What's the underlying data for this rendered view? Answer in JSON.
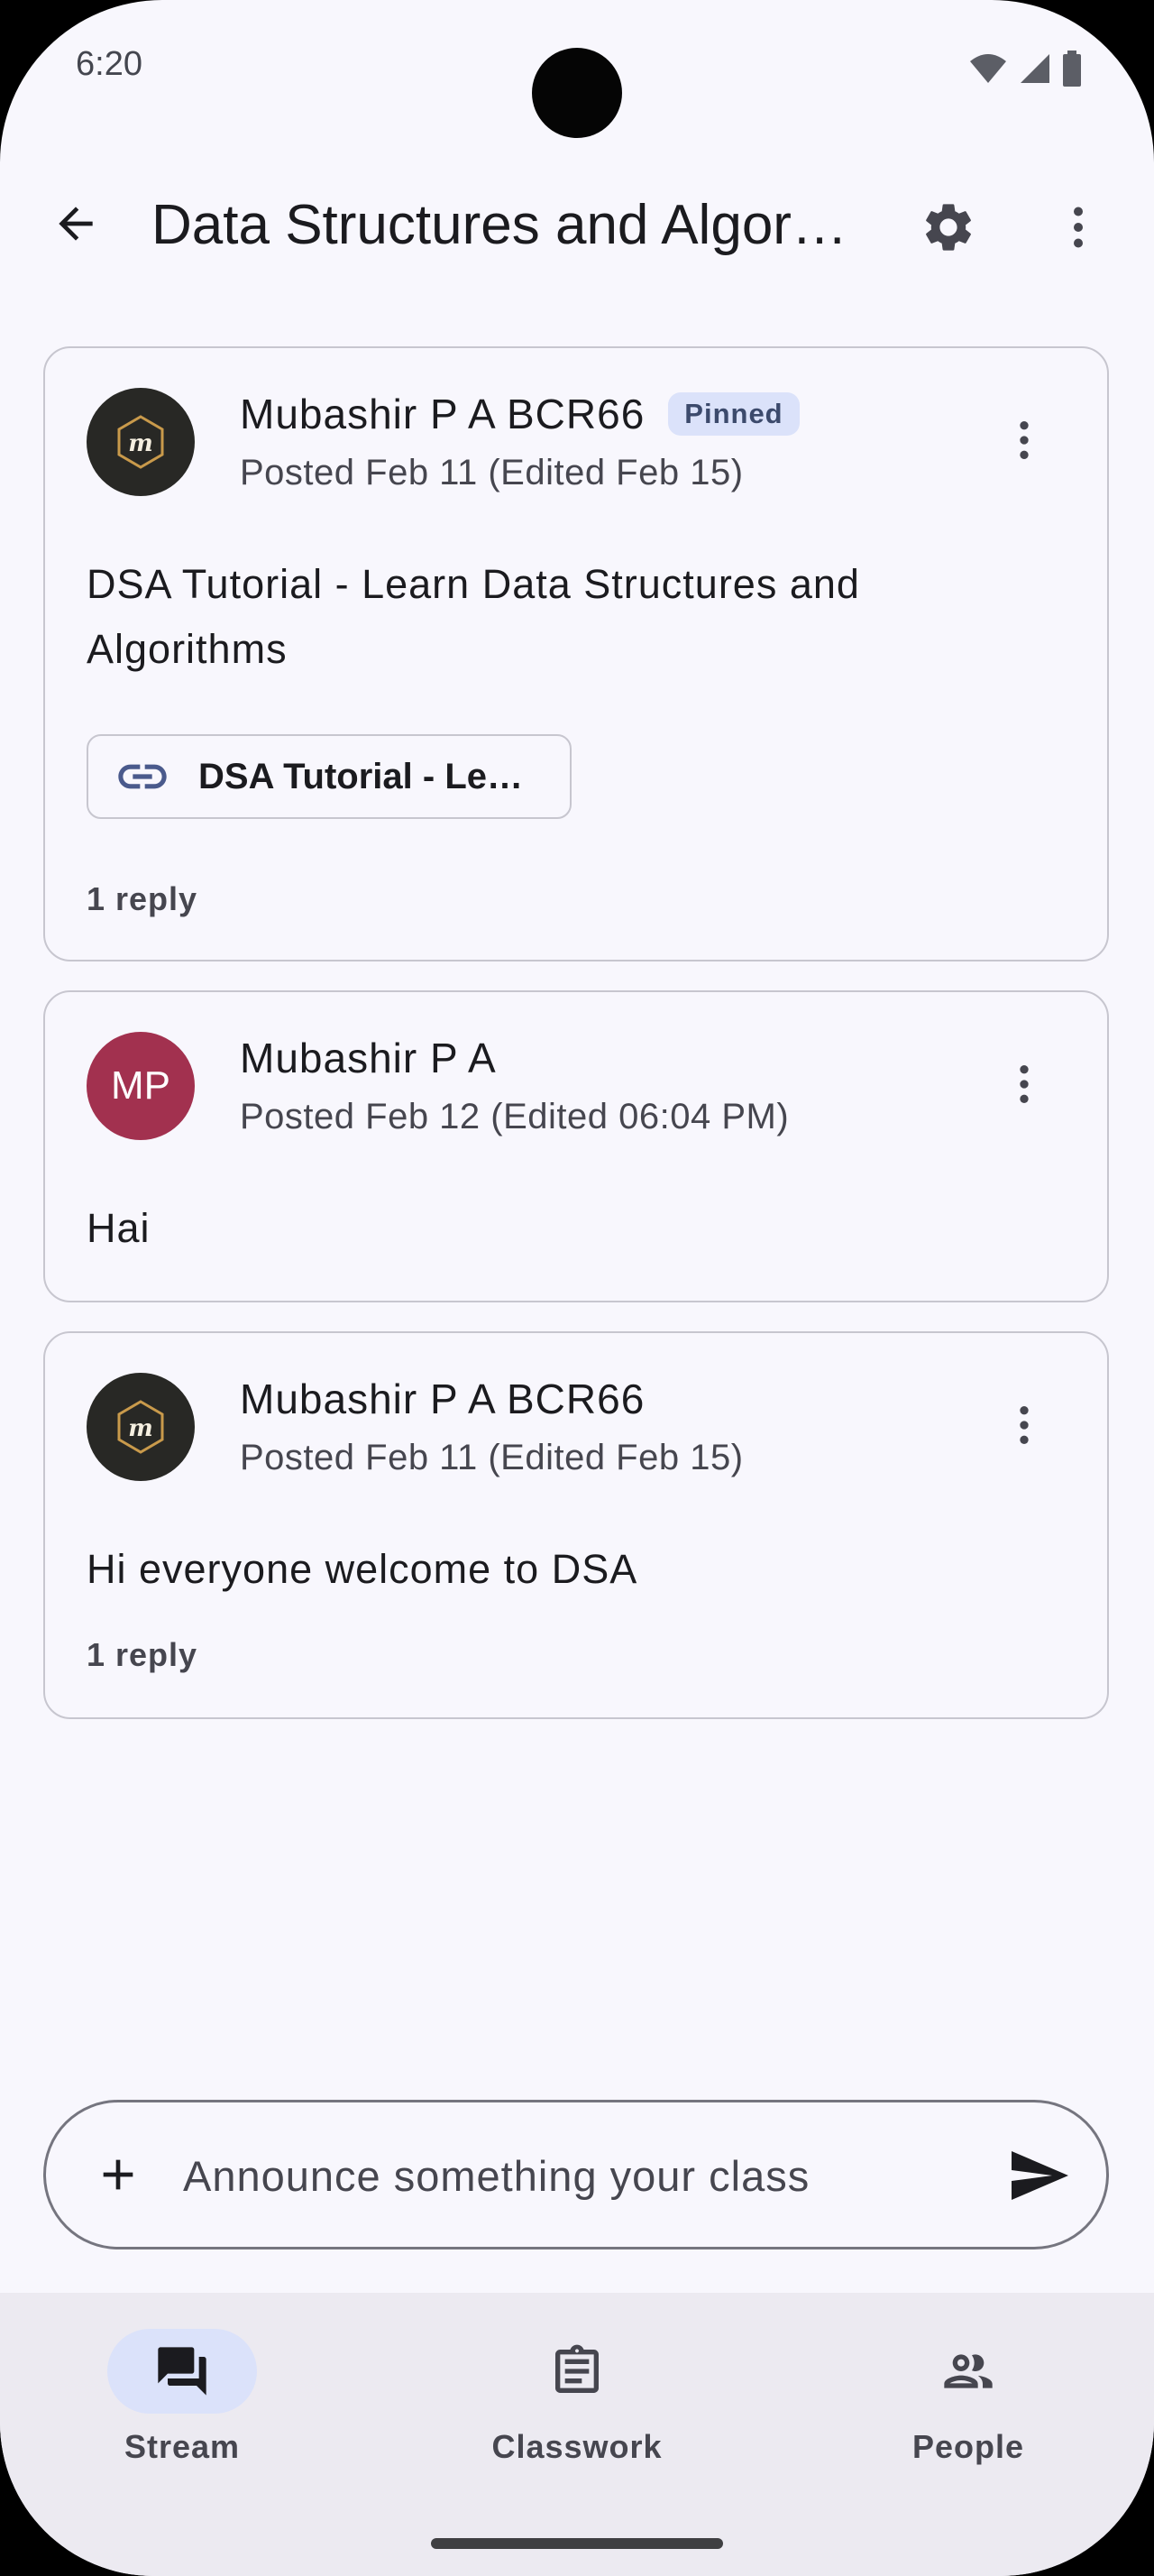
{
  "status_bar": {
    "time": "6:20",
    "icons": [
      "wifi-icon",
      "signal-icon",
      "battery-icon"
    ]
  },
  "top_bar": {
    "title": "Data Structures and Algor…",
    "back_icon": "arrow-back-icon",
    "settings_icon": "gear-icon",
    "more_icon": "more-vert-icon"
  },
  "posts": [
    {
      "author": "Mubashir P A BCR66",
      "badge": "Pinned",
      "posted": "Posted Feb 11 (Edited Feb 15)",
      "body": "DSA Tutorial - Learn Data Structures and Algorithms",
      "link_label": "DSA Tutorial - Le…",
      "replies": "1 reply",
      "avatar_logo": "m"
    },
    {
      "author": "Mubashir P A",
      "posted": "Posted Feb 12 (Edited 06:04 PM)",
      "body": "Hai",
      "avatar_initials": "MP"
    },
    {
      "author": "Mubashir P A BCR66",
      "posted": "Posted Feb 11 (Edited Feb 15)",
      "body": "Hi everyone welcome to DSA",
      "replies": "1 reply",
      "avatar_logo": "m"
    }
  ],
  "compose": {
    "placeholder": "Announce something your class"
  },
  "bottom_nav": {
    "items": [
      {
        "label": "Stream",
        "icon": "stream-icon",
        "active": true
      },
      {
        "label": "Classwork",
        "icon": "classwork-icon",
        "active": false
      },
      {
        "label": "People",
        "icon": "people-icon",
        "active": false
      }
    ]
  },
  "colors": {
    "background": "#f8f7fd",
    "pinned_badge_bg": "#dbe2fa",
    "avatar_red": "#a2314f",
    "avatar_dark": "#282825",
    "link_icon": "#4a5a8c",
    "nav_bg": "#eceaf1"
  }
}
